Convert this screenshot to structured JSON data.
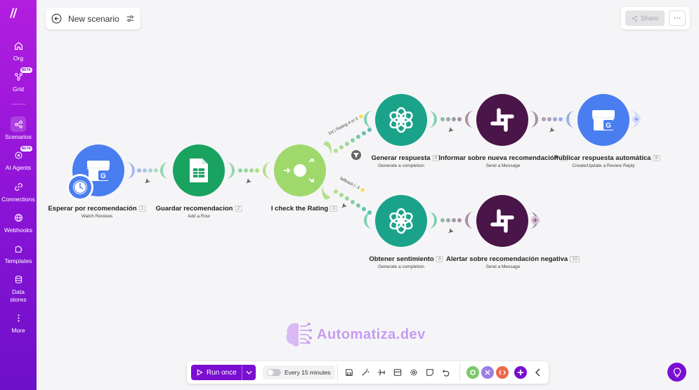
{
  "sidebar": {
    "items": [
      {
        "label": "Org",
        "icon": "home-icon"
      },
      {
        "label": "Grid",
        "icon": "grid-icon",
        "badge": "BETA"
      },
      {
        "label": "Scenarios",
        "icon": "share-nodes-icon"
      },
      {
        "label": "AI Agents",
        "icon": "ai-agent-icon",
        "badge": "BETA"
      },
      {
        "label": "Connections",
        "icon": "link-icon"
      },
      {
        "label": "Webhooks",
        "icon": "globe-icon"
      },
      {
        "label": "Templates",
        "icon": "puzzle-icon"
      },
      {
        "label": "Data stores",
        "icon": "database-icon"
      },
      {
        "label": "More",
        "icon": "more-vertical-icon"
      }
    ]
  },
  "header": {
    "title": "New scenario",
    "share_label": "Share",
    "more_label": "···"
  },
  "modules": [
    {
      "title": "Esperar por recomendación",
      "num": "1",
      "sub": "Watch Reviews",
      "app": "Google My Business",
      "color": "#4a7ef0"
    },
    {
      "title": "Guardar recomendacion",
      "num": "2",
      "sub": "Add a Row",
      "app": "Google Sheets",
      "color": "#1aa260"
    },
    {
      "title": "I check the Rating",
      "num": "3",
      "sub": "",
      "app": "Router",
      "color": "#9fd86b"
    },
    {
      "title": "Generar respuesta",
      "num": "6",
      "sub": "Generate a completion",
      "app": "OpenAI",
      "color": "#1aa38a"
    },
    {
      "title": "Informar sobre nueva recomendación",
      "num": "7",
      "sub": "Send a Message",
      "app": "Slack",
      "color": "#4a1549"
    },
    {
      "title": "Publicar respuesta automática",
      "num": "8",
      "sub": "Create/Update a Review Reply",
      "app": "Google My Business",
      "color": "#4a7ef0"
    },
    {
      "title": "Obtener sentimiento",
      "num": "9",
      "sub": "Generate a completion",
      "app": "OpenAI",
      "color": "#1aa38a"
    },
    {
      "title": "Alertar sobre recomendación negativa",
      "num": "10",
      "sub": "Send a Message",
      "app": "Slack",
      "color": "#4a1549"
    }
  ],
  "filters": {
    "top_label": "1st | Rating 4 or 5 ⭐",
    "bottom_label": "fallback | -3 ⭐"
  },
  "toolbar": {
    "run_label": "Run once",
    "schedule_label": "Every 15 minutes"
  },
  "watermark": {
    "text": "Automatiza.dev"
  },
  "colors": {
    "brand": "#7a0fd1",
    "openai": "#1aa38a",
    "slack": "#4a1549",
    "gmb": "#4a7ef0",
    "sheets": "#1aa260",
    "router": "#9fd86b"
  }
}
